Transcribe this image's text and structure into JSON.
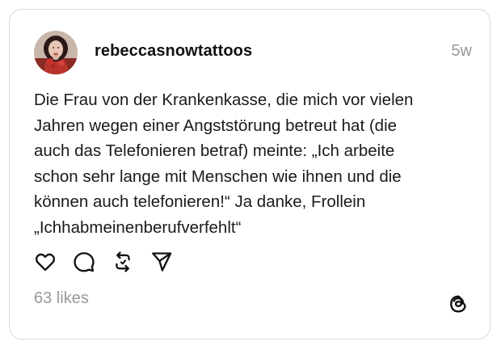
{
  "post": {
    "username": "rebeccasnowtattoos",
    "time_ago": "5w",
    "text_lines": [
      "Die Frau von der Krankenkasse, die mich vor vielen",
      "Jahren wegen einer Angststörung betreut hat (die",
      "auch das Telefonieren betraf) meinte: „Ich arbeite",
      "schon sehr lange mit Menschen wie ihnen und die",
      "können auch telefonieren!“ Ja danke, Frollein",
      "„Ichhabmeinenberufverfehlt“"
    ],
    "likes": "63 likes"
  },
  "icons": {
    "like": "heart-icon",
    "reply": "comment-icon",
    "repost": "repost-icon",
    "share": "send-icon",
    "brand": "threads-logo-icon"
  },
  "colors": {
    "text": "#1a1a1a",
    "muted": "#999999",
    "border": "#d9d9d9"
  }
}
